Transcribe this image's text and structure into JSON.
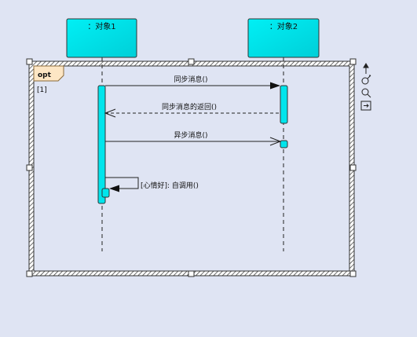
{
  "diagram": {
    "type": "uml-sequence",
    "objects": [
      {
        "id": "obj1",
        "label": "：对象1"
      },
      {
        "id": "obj2",
        "label": "：对象2"
      }
    ],
    "fragment": {
      "operator": "opt",
      "guard": "[1]"
    },
    "messages": [
      {
        "from": "obj1",
        "to": "obj2",
        "label": "同步消息()",
        "kind": "sync"
      },
      {
        "from": "obj2",
        "to": "obj1",
        "label": "同步消息的返回()",
        "kind": "return"
      },
      {
        "from": "obj1",
        "to": "obj2",
        "label": "异步消息()",
        "kind": "async"
      },
      {
        "from": "obj1",
        "to": "obj1",
        "label": "[心情好]: 自调用()",
        "kind": "self"
      }
    ],
    "toolbar": [
      {
        "icon": "arrow-up-icon"
      },
      {
        "icon": "link-icon"
      },
      {
        "icon": "zoom-icon"
      },
      {
        "icon": "fit-icon"
      }
    ],
    "colors": {
      "background": "#dfe4f3",
      "object_fill": "#00e5ec",
      "activation_fill": "#00e5ec",
      "fragment_tab": "#fde6c4"
    }
  }
}
